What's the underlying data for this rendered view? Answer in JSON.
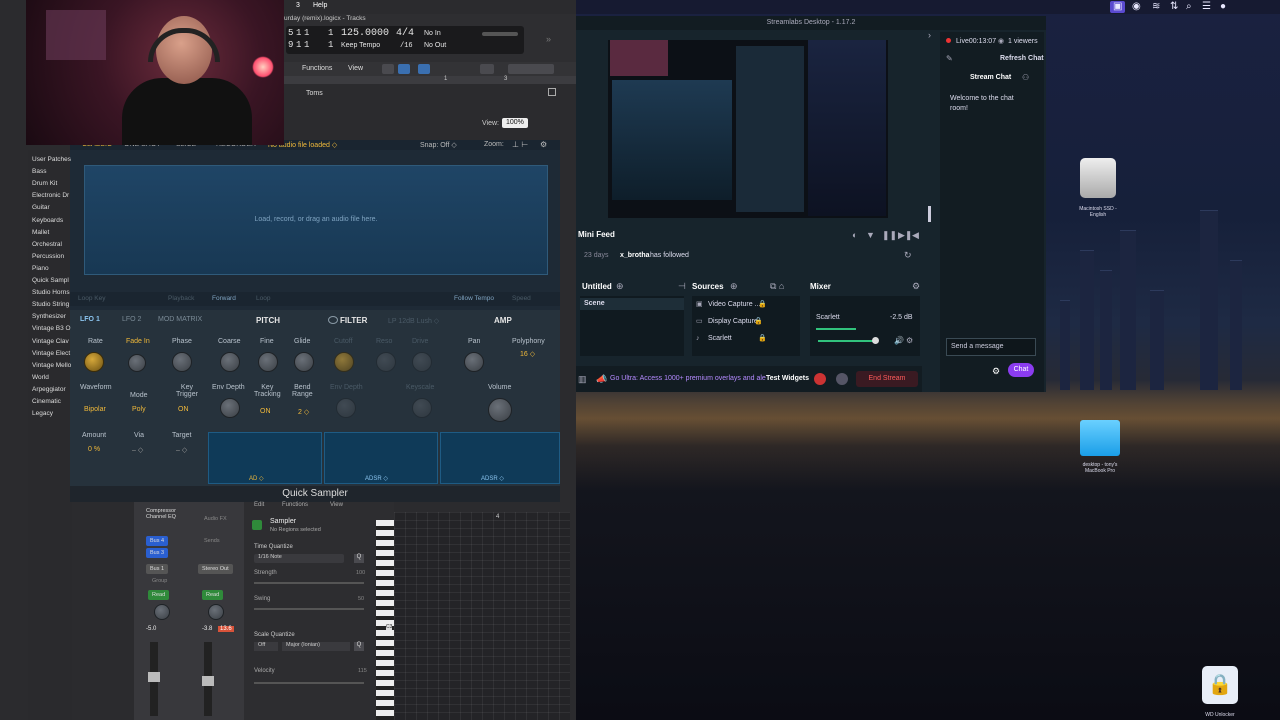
{
  "menubar": {
    "view": "w",
    "window": "3",
    "help": "Help"
  },
  "logic": {
    "window_title": "urday (remix).logicx - Tracks",
    "lcd": {
      "bar1": "5",
      "beat1": "1",
      "div1": "1",
      "tick1": "1",
      "bar2": "9",
      "beat2": "1",
      "div2": "1",
      "tick2": "1",
      "tempo": "125.0000",
      "keep_tempo": "Keep Tempo",
      "signature": "4/4",
      "division": "/16",
      "in": "No In",
      "out": "No Out"
    },
    "toolbar": {
      "functions": "Functions",
      "view": "View"
    },
    "track_name": "Toms",
    "view_label": "View:",
    "zoom_pct": "100%",
    "ruler_marks": [
      "1",
      "3"
    ],
    "library": [
      "User Patches",
      "Bass",
      "Drum Kit",
      "Electronic Dr",
      "Guitar",
      "Keyboards",
      "Mallet",
      "Orchestral",
      "Percussion",
      "Piano",
      "Quick Sampl",
      "Studio Horns",
      "Studio String",
      "Synthesizer",
      "Vintage B3 O",
      "Vintage Clav",
      "Vintage Elect",
      "Vintage Mello",
      "World",
      "Arpeggiator",
      "Cinematic",
      "Legacy"
    ],
    "sampler": {
      "tabs": [
        "CLASSIC",
        "ONE SHOT",
        "SLICE",
        "RECORDER"
      ],
      "no_file": "No audio file loaded ◇",
      "snap": "Snap: Off ◇",
      "zoom": "Zoom:",
      "drop_hint": "Load, record, or drag an audio file here.",
      "ctl_left": "Loop Key",
      "ctl_playback": "Playback",
      "ctl_forward": "Forward",
      "ctl_loop": "Loop",
      "follow_tempo": "Follow Tempo",
      "speed": "Speed",
      "mod_tabs": [
        "LFO 1",
        "LFO 2",
        "MOD MATRIX"
      ],
      "pitch": "PITCH",
      "filter": "FILTER",
      "filter_type": "LP 12dB Lush ◇",
      "amp": "AMP",
      "lfo_labels": {
        "rate": "Rate",
        "fade": "Fade In",
        "phase": "Phase",
        "waveform": "Waveform",
        "mode": "Mode",
        "key_trigger": "Key\nTrigger",
        "bipolar": "Bipolar",
        "poly": "Poly",
        "on": "ON",
        "amount": "Amount",
        "via": "Via",
        "target": "Target",
        "amount_val": "0 %",
        "via_val": "– ◇",
        "target_val": "– ◇"
      },
      "pitch_labels": {
        "coarse": "Coarse",
        "fine": "Fine",
        "glide": "Glide",
        "env_depth": "Env Depth",
        "key_tracking": "Key\nTracking",
        "bend_range": "Bend\nRange",
        "kt_val": "ON",
        "bend_val": "2 ◇"
      },
      "filter_labels": {
        "cutoff": "Cutoff",
        "reso": "Reso",
        "drive": "Drive",
        "env_depth": "Env Depth",
        "keyscale": "Keyscale"
      },
      "amp_labels": {
        "pan": "Pan",
        "polyphony": "Polyphony",
        "poly_val": "16 ◇",
        "volume": "Volume"
      },
      "env_labels": [
        "AD ◇",
        "ADSR ◇",
        "ADSR ◇"
      ],
      "title": "Quick Sampler"
    },
    "mixer": {
      "plugins": "Compressor\nChannel EQ",
      "audio_fx": "Audio FX",
      "sends": "Sends",
      "bus4": "Bus 4",
      "bus3": "Bus 3",
      "bus1": "Bus 1",
      "stereo_out": "Stereo Out",
      "group": "Group",
      "read": "Read",
      "read2": "Read",
      "vol1": "-5.0",
      "vol2": "-3.8",
      "peak2": "13.6"
    },
    "editor": {
      "edit": "Edit",
      "functions": "Functions",
      "view": "View",
      "region": "Sampler",
      "no_regions": "No Regions selected",
      "time_quantize": "Time Quantize",
      "note": "1/16 Note",
      "strength": "Strength",
      "strength_val": "100",
      "swing": "Swing",
      "swing_val": "50",
      "scale_quantize": "Scale Quantize",
      "off": "Off",
      "scale": "Major (Ionian)",
      "velocity": "Velocity",
      "velocity_val": "115",
      "bar4": "4",
      "c3": "C3"
    }
  },
  "streamlabs": {
    "title": "Streamlabs Desktop - 1.17.2",
    "live": "Live00:13:07",
    "viewers": "1 viewers",
    "stream_chat": "Stream Chat",
    "refresh_chat": "Refresh Chat",
    "welcome": "Welcome to the chat room!",
    "send_placeholder": "Send a message",
    "chat_button": "Chat",
    "mini_feed": "Mini Feed",
    "feed_time": "23 days",
    "feed_user": "x_brotha",
    "feed_action": "has followed",
    "scenes_title": "Untitled",
    "scene_item": "Scene",
    "sources_title": "Sources",
    "sources": [
      "Video Capture ...",
      "Display Capture",
      "Scarlett"
    ],
    "mixer_title": "Mixer",
    "mixer_source": "Scarlett",
    "mixer_db": "-2.5 dB",
    "ultra_promo": "Go Ultra: Access 1000+ premium overlays and ale",
    "test_widgets": "Test Widgets",
    "end_stream": "End Stream"
  },
  "desktop": {
    "drive_label": "Macintosh SSD -\nEnglish",
    "folder_label": "desktop - tony's\nMacBook Pro",
    "vpn_label": "WD Unlocker"
  }
}
